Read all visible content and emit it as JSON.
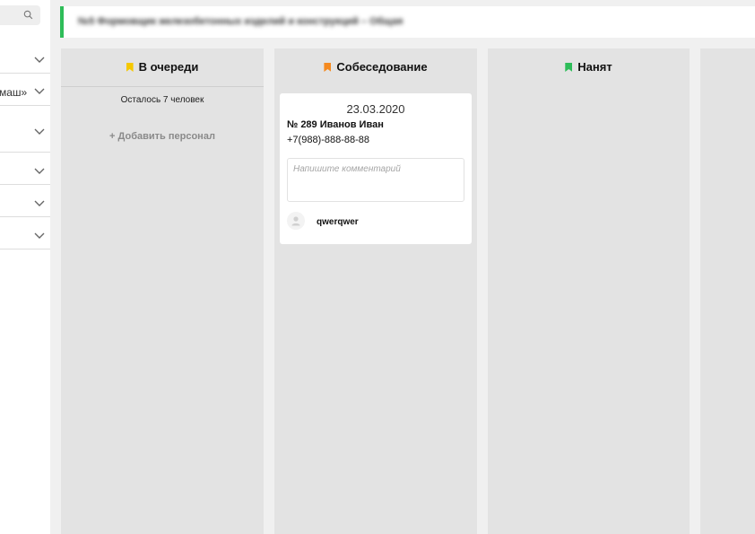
{
  "sidebar": {
    "partial_label": "маш»"
  },
  "header": {
    "title": "№5 Формовщик железобетонных изделий и конструкций – Общая"
  },
  "columns": [
    {
      "title": "В очереди",
      "bookmark_color": "#f5c800",
      "remaining": "Осталось 7 человек",
      "add_label": "+ Добавить персонал"
    },
    {
      "title": "Собеседование",
      "bookmark_color": "#f58a1f"
    },
    {
      "title": "Нанят",
      "bookmark_color": "#2ebd59"
    },
    {
      "title": ""
    }
  ],
  "card": {
    "date": "23.03.2020",
    "name": "№ 289 Иванов Иван",
    "phone": "+7(988)-888-88-88",
    "comment_placeholder": "Напишите комментарий",
    "user": "qwerqwer"
  },
  "colors": {
    "accent": "#2ebd59",
    "column_bg": "#e3e3e3",
    "page_bg": "#f0f0f0"
  }
}
